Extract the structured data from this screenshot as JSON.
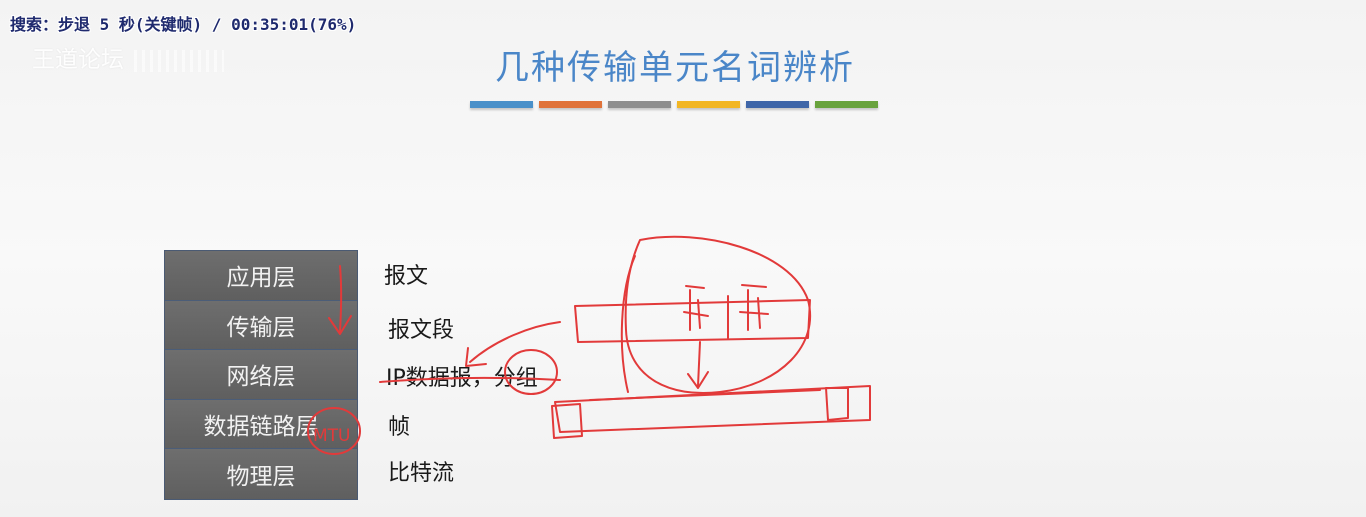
{
  "osd": {
    "text": "搜索：步退 5 秒(关键帧) / 00:35:01(76%)"
  },
  "watermark": {
    "text": "王道论坛"
  },
  "slide": {
    "title": "几种传输单元名词辨析",
    "accent_colors": [
      "#4a90c9",
      "#e0733a",
      "#8e8e8e",
      "#f2b624",
      "#3f66a8",
      "#69a33d"
    ],
    "layers": [
      {
        "name": "应用层",
        "unit": "报文"
      },
      {
        "name": "传输层",
        "unit": "报文段"
      },
      {
        "name": "网络层",
        "unit": "IP数据报，分组"
      },
      {
        "name": "数据链路层",
        "unit": "帧"
      },
      {
        "name": "物理层",
        "unit": "比特流"
      }
    ]
  },
  "annotations": {
    "ink_color": "#e23a3a",
    "labels": [
      "MTU"
    ]
  }
}
